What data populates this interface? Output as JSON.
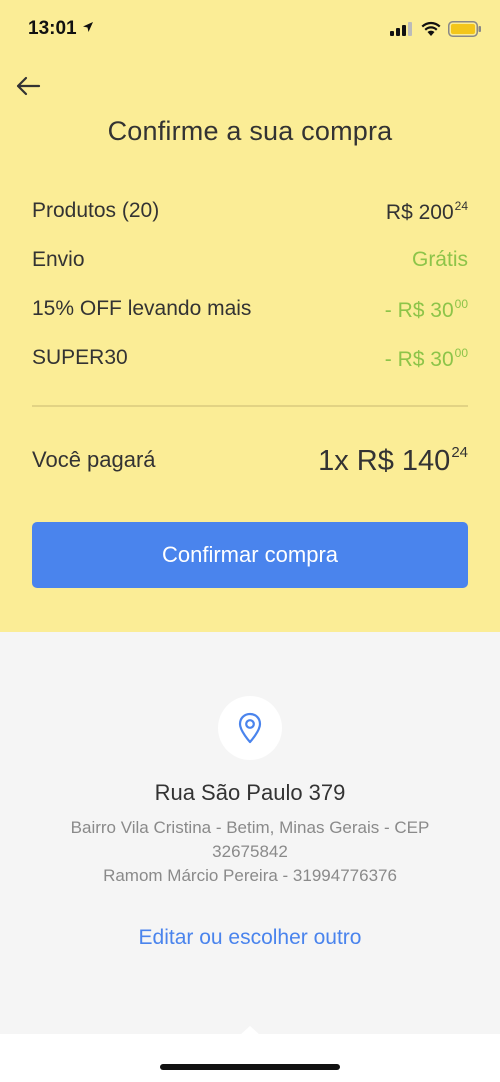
{
  "status_bar": {
    "time": "13:01"
  },
  "header": {
    "title": "Confirme a sua compra"
  },
  "summary": {
    "rows": [
      {
        "label": "Produtos (20)",
        "value_main": "R$ 200",
        "value_cents": "24",
        "color": "#333333"
      },
      {
        "label": "Envio",
        "value_main": "Grátis",
        "value_cents": "",
        "color": "#8dc449"
      },
      {
        "label": "15% OFF levando mais",
        "value_main": "- R$ 30",
        "value_cents": "00",
        "color": "#8dc449"
      },
      {
        "label": "SUPER30",
        "value_main": "- R$ 30",
        "value_cents": "00",
        "color": "#8dc449"
      }
    ],
    "total_label": "Você pagará",
    "total_main": "1x R$ 140",
    "total_cents": "24"
  },
  "actions": {
    "confirm_label": "Confirmar compra",
    "edit_label": "Editar ou escolher outro"
  },
  "address": {
    "street": "Rua São Paulo 379",
    "line1": "Bairro Vila Cristina - Betim, Minas Gerais - CEP",
    "line2": "32675842",
    "line3": "Ramom Márcio Pereira - 31994776376"
  },
  "colors": {
    "accent_yellow": "#fbed96",
    "primary_blue": "#4a84ed",
    "success_green": "#8dc449"
  }
}
